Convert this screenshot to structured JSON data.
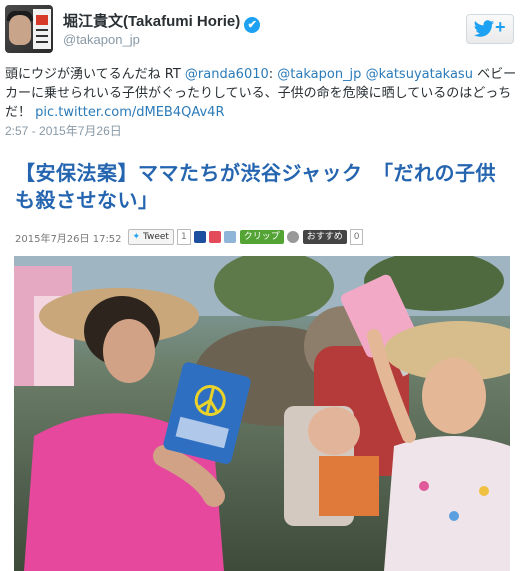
{
  "tweet": {
    "author_name": "堀江貴文(Takafumi Horie)",
    "verified_mark": "✔",
    "handle": "@takapon_jp",
    "text_before_link": "頭にウジが湧いてるんだね RT ",
    "mention_1": "@randa6010",
    "text_sep_1": ": ",
    "mention_2": "@takapon_jp",
    "text_sep_2": " ",
    "mention_3": "@katsuyatakasu",
    "text_body": " ベビーカーに乗せられいる子供がぐったりしている、子供の命を危険に晒しているのはどっちだ！ ",
    "pic_link": "pic.twitter.com/dMEB4QAv4R",
    "timestamp": "2:57 - 2015年7月26日"
  },
  "follow_button": {
    "plus": "+",
    "icon": "twitter-bird-icon"
  },
  "card": {
    "headline": "【安保法案】ママたちが渋谷ジャック　「だれの子供も殺させない」",
    "date": "2015年7月26日 17:52",
    "tweet_label": "Tweet",
    "tweet_count": "1",
    "clip_label": "クリップ",
    "recommend_label": "おすすめ",
    "recommend_count": "0"
  },
  "colors": {
    "headline": "#2565b0",
    "link": "#2b7bb9",
    "twitter_blue": "#1da1f2"
  }
}
